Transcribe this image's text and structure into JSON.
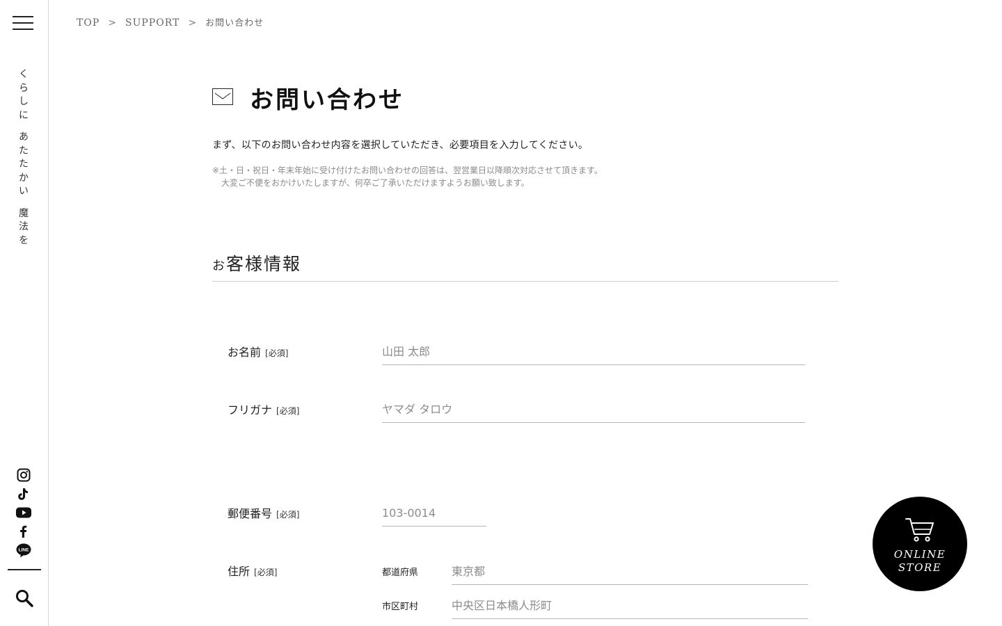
{
  "sidebar": {
    "tagline": [
      "くらしに",
      "あたたかい",
      "魔法を"
    ],
    "social": [
      {
        "icon": "instagram-icon"
      },
      {
        "icon": "tiktok-icon"
      },
      {
        "icon": "youtube-icon"
      },
      {
        "icon": "facebook-icon"
      },
      {
        "icon": "line-icon",
        "text": "LINE"
      }
    ]
  },
  "breadcrumb": {
    "items": [
      "TOP",
      "SUPPORT"
    ],
    "separator": ">",
    "current": "お問い合わせ"
  },
  "header": {
    "title": "お問い合わせ",
    "intro": "まず、以下のお問い合わせ内容を選択していただき、必要項目を入力してください。",
    "note_line1": "※土・日・祝日・年末年始に受け付けたお問い合わせの回答は、翌営業日以降順次対応させて頂きます。",
    "note_line2": "大変ご不便をおかけいたしますが、何卒ご了承いただけますようお願い致します。"
  },
  "section": {
    "title_prefix": "お",
    "title_rest": "客様情報"
  },
  "form": {
    "required_mark": "[必須]",
    "name": {
      "label": "お名前",
      "placeholder": "山田 太郎",
      "value": ""
    },
    "furigana": {
      "label": "フリガナ",
      "placeholder": "ヤマダ タロウ",
      "value": ""
    },
    "postal": {
      "label": "郵便番号",
      "placeholder": "103-0014",
      "value": ""
    },
    "address": {
      "label": "住所",
      "prefecture": {
        "label": "都道府県",
        "placeholder": "東京都",
        "value": ""
      },
      "city": {
        "label": "市区町村",
        "placeholder": "中央区日本橋人形町",
        "value": ""
      }
    }
  },
  "store": {
    "line1": "ONLINE",
    "line2": "STORE"
  }
}
